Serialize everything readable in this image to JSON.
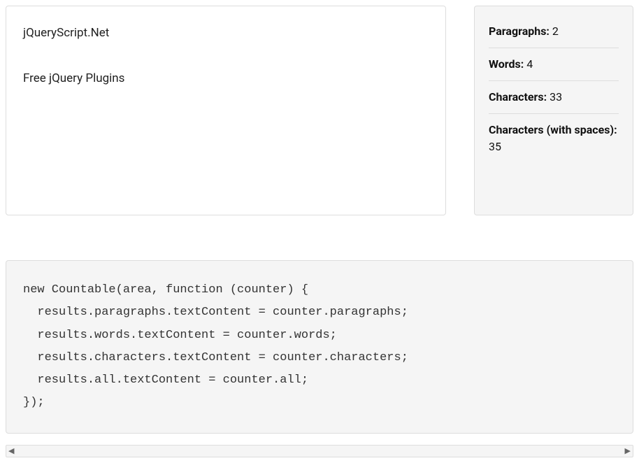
{
  "textarea": {
    "value": "jQueryScript.Net\n\nFree jQuery Plugins"
  },
  "stats": {
    "paragraphs": {
      "label": "Paragraphs:",
      "value": "2"
    },
    "words": {
      "label": "Words:",
      "value": "4"
    },
    "characters": {
      "label": "Characters:",
      "value": "33"
    },
    "all": {
      "label": "Characters (with spaces):",
      "value": "35"
    }
  },
  "code": {
    "content": "new Countable(area, function (counter) {\n  results.paragraphs.textContent = counter.paragraphs;\n  results.words.textContent = counter.words;\n  results.characters.textContent = counter.characters;\n  results.all.textContent = counter.all;\n});"
  }
}
